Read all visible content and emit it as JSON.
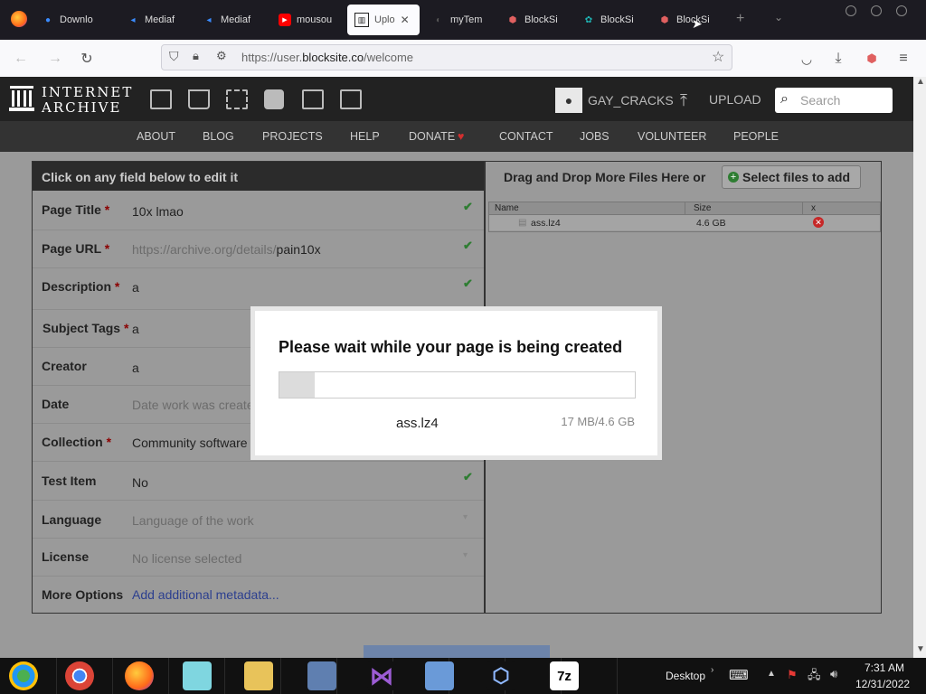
{
  "browser": {
    "tabs": [
      {
        "label": "Downlo",
        "icon": "blue-dot-icon"
      },
      {
        "label": "Mediaf",
        "icon": "mediafire-icon"
      },
      {
        "label": "Mediaf",
        "icon": "mediafire-icon"
      },
      {
        "label": "mousou",
        "icon": "youtube-icon"
      },
      {
        "label": "Uplo",
        "icon": "archive-icon"
      },
      {
        "label": "myTem",
        "icon": "mytemp-icon"
      },
      {
        "label": "BlockSi",
        "icon": "blocksite-icon"
      },
      {
        "label": "BlockSi",
        "icon": "blocksite-teal-icon"
      },
      {
        "label": "BlockSi",
        "icon": "blocksite-icon"
      }
    ],
    "url_prefix": "https://user.",
    "url_domain": "blocksite.co",
    "url_path": "/welcome"
  },
  "ia_header": {
    "logo_line1": "INTERNET",
    "logo_line2": "ARCHIVE",
    "username": "GAY_CRACKS",
    "upload_label": "UPLOAD",
    "search_placeholder": "Search",
    "nav": [
      "ABOUT",
      "BLOG",
      "PROJECTS",
      "HELP",
      "DONATE",
      "CONTACT",
      "JOBS",
      "VOLUNTEER",
      "PEOPLE"
    ]
  },
  "form": {
    "header": "Click on any field below to edit it",
    "fields": [
      {
        "label": "Page Title",
        "required": "*",
        "value": "10x lmao"
      },
      {
        "label": "Page URL",
        "required": "*",
        "prefix": "https://archive.org/details/",
        "value": "pain10x"
      },
      {
        "label": "Description",
        "required": "*",
        "value": "a"
      },
      {
        "label": "Subject Tags",
        "required": "*",
        "value": "a"
      },
      {
        "label": "Creator",
        "required": "",
        "value": "a"
      },
      {
        "label": "Date",
        "required": "",
        "value": "Date work was create"
      },
      {
        "label": "Collection",
        "required": "*",
        "value": "Community software"
      },
      {
        "label": "Test Item",
        "required": "",
        "value": "No"
      },
      {
        "label": "Language",
        "required": "",
        "value": "Language of the work"
      },
      {
        "label": "License",
        "required": "",
        "value": "No license selected"
      },
      {
        "label": "More Options",
        "required": "",
        "value": "Add additional metadata..."
      }
    ]
  },
  "files": {
    "drag_text": "Drag and Drop More Files Here or",
    "select_label": "Select files to add",
    "columns": [
      "Name",
      "Size",
      "x"
    ],
    "rows": [
      {
        "name": "ass.lz4",
        "size": "4.6 GB"
      }
    ]
  },
  "dialog": {
    "title": "Please wait while your page is being created",
    "filename": "ass.lz4",
    "progress_text": "17 MB/4.6 GB",
    "progress_fraction": 0.1
  },
  "taskbar": {
    "desktop_label": "Desktop",
    "time": "7:31 AM",
    "date": "12/31/2022"
  }
}
